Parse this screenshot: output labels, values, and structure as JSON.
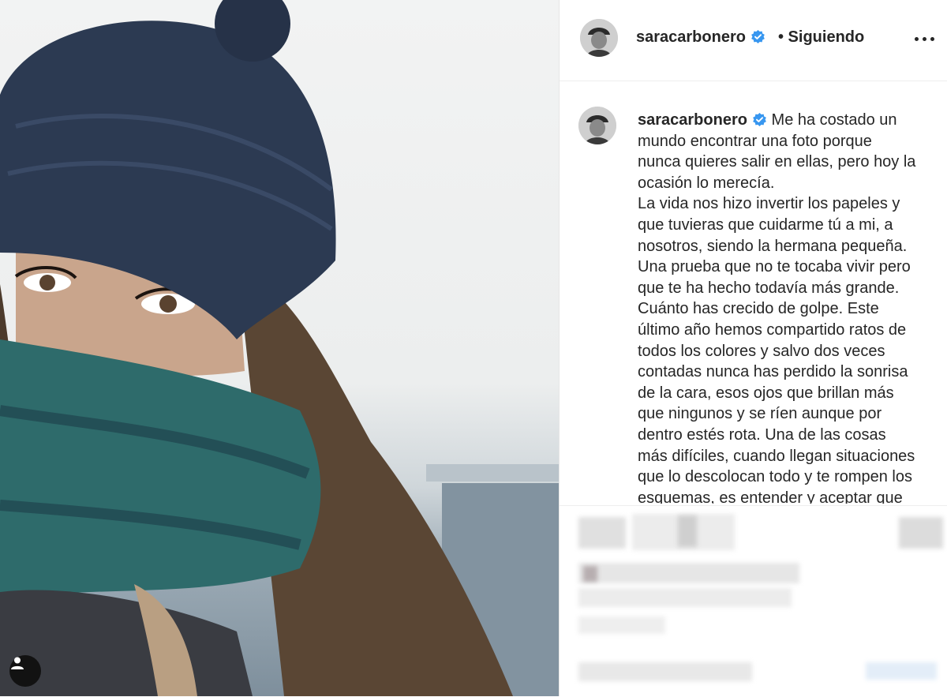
{
  "post": {
    "username": "saracarbonero",
    "follow_status": "• Siguiendo",
    "caption_lines": [
      "Me ha costado un",
      "mundo encontrar una foto porque",
      "nunca quieres salir en ellas, pero hoy la",
      "ocasión lo merecía.",
      "La vida nos hizo invertir los papeles y",
      "que tuvieras que cuidarme tú a mi, a",
      "nosotros, siendo la hermana pequeña.",
      "Una prueba que no te tocaba vivir pero",
      "que te ha hecho todavía más grande.",
      "Cuánto has crecido de golpe. Este",
      "último año hemos compartido ratos de",
      "todos los colores y salvo dos veces",
      "contadas nunca has perdido la sonrisa",
      "de la cara, esos ojos que brillan más",
      "que ningunos y se ríen aunque por",
      "dentro estés rota. Una de las cosas",
      "más difíciles, cuando llegan situaciones",
      "que lo descolocan todo y te rompen los",
      "esquemas, es entender y aceptar que"
    ]
  },
  "icons": {
    "verified": "verified-badge-icon",
    "more": "more-options-icon",
    "tagged_user": "user-tag-icon"
  },
  "colors": {
    "verified_blue": "#3897f0",
    "text": "#262626"
  }
}
